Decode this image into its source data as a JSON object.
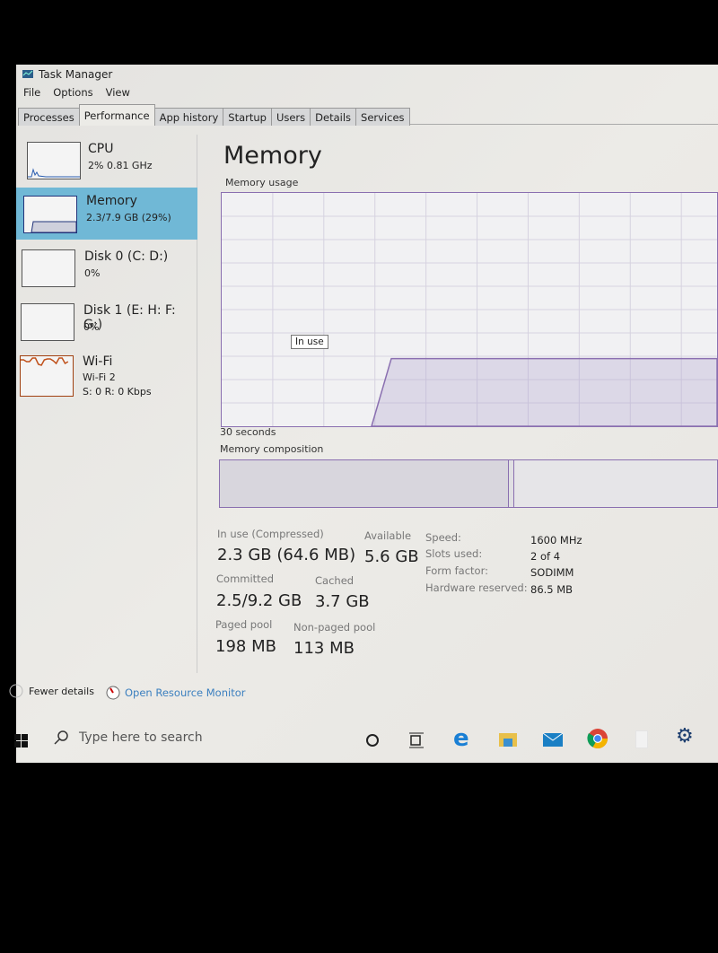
{
  "window": {
    "title": "Task Manager",
    "menu": [
      "File",
      "Options",
      "View"
    ]
  },
  "tabs": [
    {
      "label": "Processes"
    },
    {
      "label": "Performance",
      "active": true
    },
    {
      "label": "App history"
    },
    {
      "label": "Startup"
    },
    {
      "label": "Users"
    },
    {
      "label": "Details"
    },
    {
      "label": "Services"
    }
  ],
  "sidebar": {
    "items": [
      {
        "name": "CPU",
        "sub1": "2% 0.81 GHz"
      },
      {
        "name": "Memory",
        "sub1": "2.3/7.9 GB (29%)",
        "selected": true
      },
      {
        "name": "Disk 0 (C: D:)",
        "sub1": "0%"
      },
      {
        "name": "Disk 1 (E: H: F: G:)",
        "sub1": "0%"
      },
      {
        "name": "Wi-Fi",
        "sub1": "Wi-Fi 2",
        "sub2": "S: 0 R: 0 Kbps"
      }
    ]
  },
  "main": {
    "title": "Memory",
    "usage_label": "Memory usage",
    "usage_percent": 29,
    "tooltip": "In use",
    "time_label": "30 seconds",
    "composition_label": "Memory composition",
    "stats": {
      "in_use_label": "In use (Compressed)",
      "in_use_value": "2.3 GB (64.6 MB)",
      "available_label": "Available",
      "available_value": "5.6 GB",
      "committed_label": "Committed",
      "committed_value": "2.5/9.2 GB",
      "cached_label": "Cached",
      "cached_value": "3.7 GB",
      "paged_label": "Paged pool",
      "paged_value": "198 MB",
      "nonpaged_label": "Non-paged pool",
      "nonpaged_value": "113 MB"
    },
    "specs": [
      {
        "label": "Speed:",
        "value": "1600 MHz"
      },
      {
        "label": "Slots used:",
        "value": "2 of 4"
      },
      {
        "label": "Form factor:",
        "value": "SODIMM"
      },
      {
        "label": "Hardware reserved:",
        "value": "86.5 MB"
      }
    ]
  },
  "footer": {
    "fewer_details": "Fewer details",
    "resource_monitor": "Open Resource Monitor"
  },
  "taskbar": {
    "search_placeholder": "Type here to search",
    "icons": [
      "windows-start-icon",
      "search-icon",
      "cortana-icon",
      "task-view-icon",
      "edge-icon",
      "file-explorer-icon",
      "mail-icon",
      "chrome-icon",
      "blank-app-icon",
      "settings-icon"
    ]
  },
  "colors": {
    "memory_accent": "#8a6fb0",
    "selected_bg": "#70b8d6",
    "link": "#3b7fbf",
    "wifi": "#c0501a",
    "cpu": "#2a5db0"
  }
}
